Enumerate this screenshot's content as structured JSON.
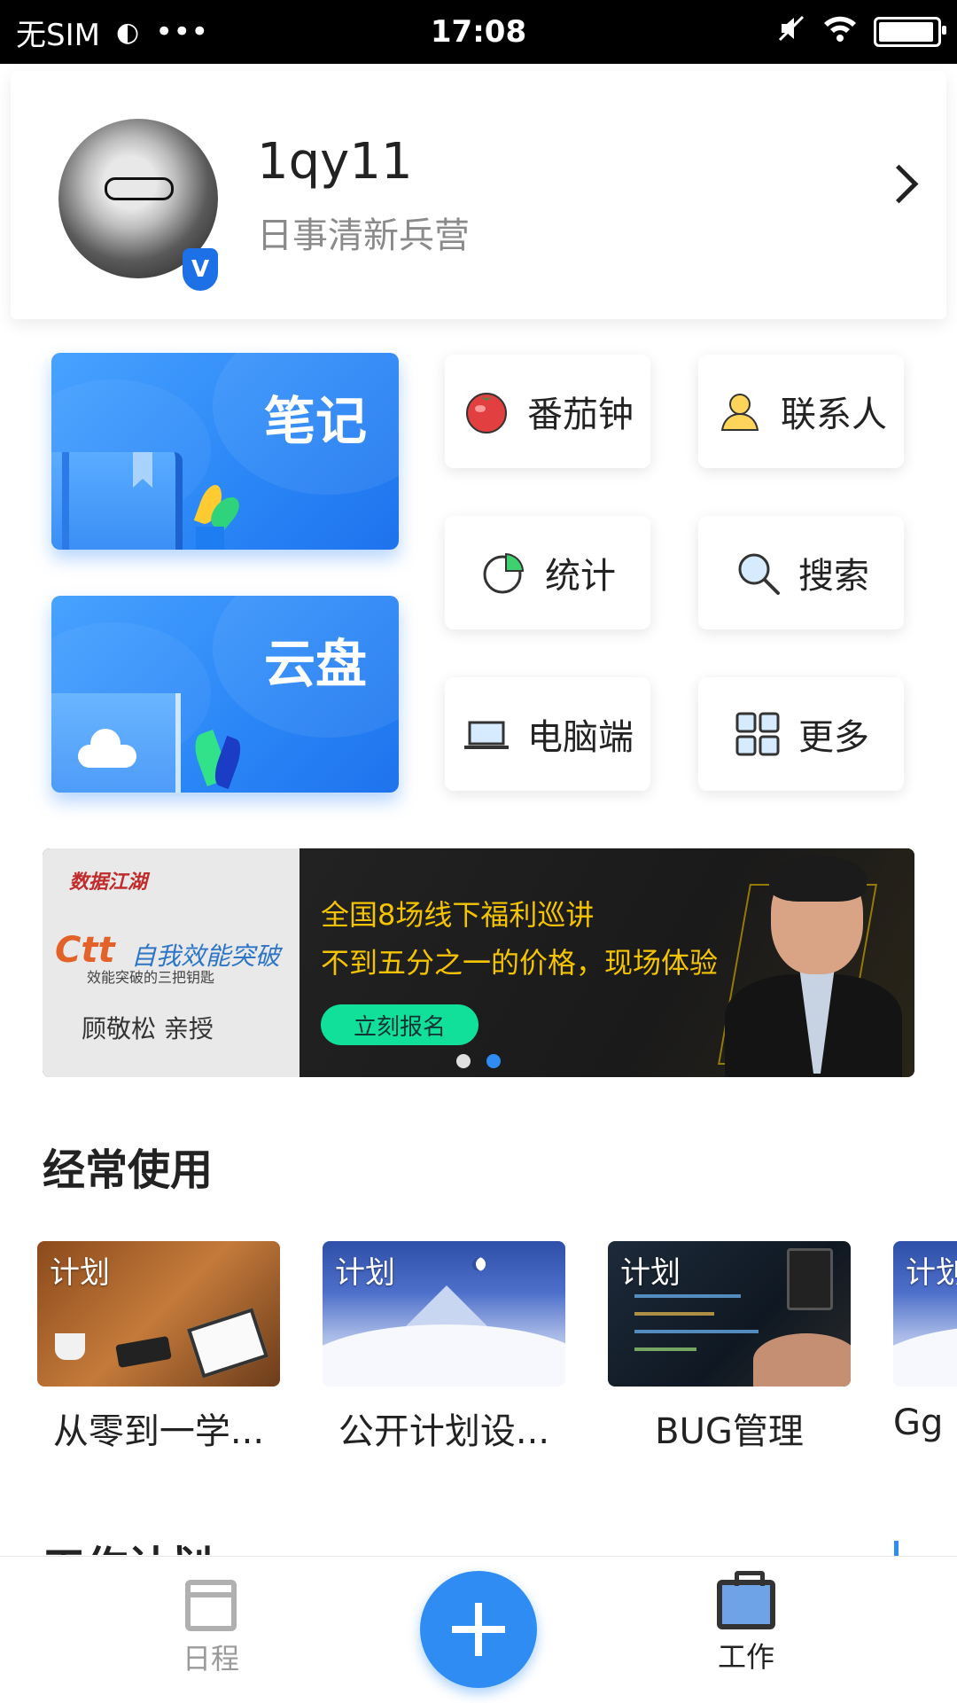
{
  "status_bar": {
    "carrier": "无SIM",
    "more": "•••",
    "time": "17:08",
    "battery_level": 0.95
  },
  "profile": {
    "name": "1qy11",
    "subtitle": "日事清新兵营",
    "badge": "V"
  },
  "feature_tiles": {
    "notes": "笔记",
    "cloud": "云盘"
  },
  "quick_actions": [
    {
      "label": "番茄钟",
      "icon": "tomato-icon"
    },
    {
      "label": "联系人",
      "icon": "contact-icon"
    },
    {
      "label": "统计",
      "icon": "stats-pie-icon"
    },
    {
      "label": "搜索",
      "icon": "search-icon"
    },
    {
      "label": "电脑端",
      "icon": "laptop-icon"
    },
    {
      "label": "更多",
      "icon": "grid-icon"
    }
  ],
  "banner": {
    "left_logo": "数据江湖",
    "ctt": "Ctt",
    "ctt_title": "自我效能突破",
    "ctt_sub": "效能突破的三把钥匙",
    "teacher": "顾敬松 亲授",
    "line1": "全国8场线下福利巡讲",
    "line2": "不到五分之一的价格，现场体验",
    "cta": "立刻报名",
    "active_dot": 2
  },
  "frequent": {
    "title": "经常使用",
    "items": [
      {
        "tag": "计划",
        "title": "从零到一学..."
      },
      {
        "tag": "计划",
        "title": "公开计划设..."
      },
      {
        "tag": "计划",
        "title": "BUG管理"
      },
      {
        "tag": "计划",
        "title": "Gg"
      }
    ]
  },
  "work_plan": {
    "title": "工作计划"
  },
  "bottom_nav": {
    "schedule": "日程",
    "work": "工作"
  },
  "colors": {
    "accent": "#2e8cf3",
    "banner_yellow": "#f5c400",
    "cta_green": "#11e09b"
  }
}
